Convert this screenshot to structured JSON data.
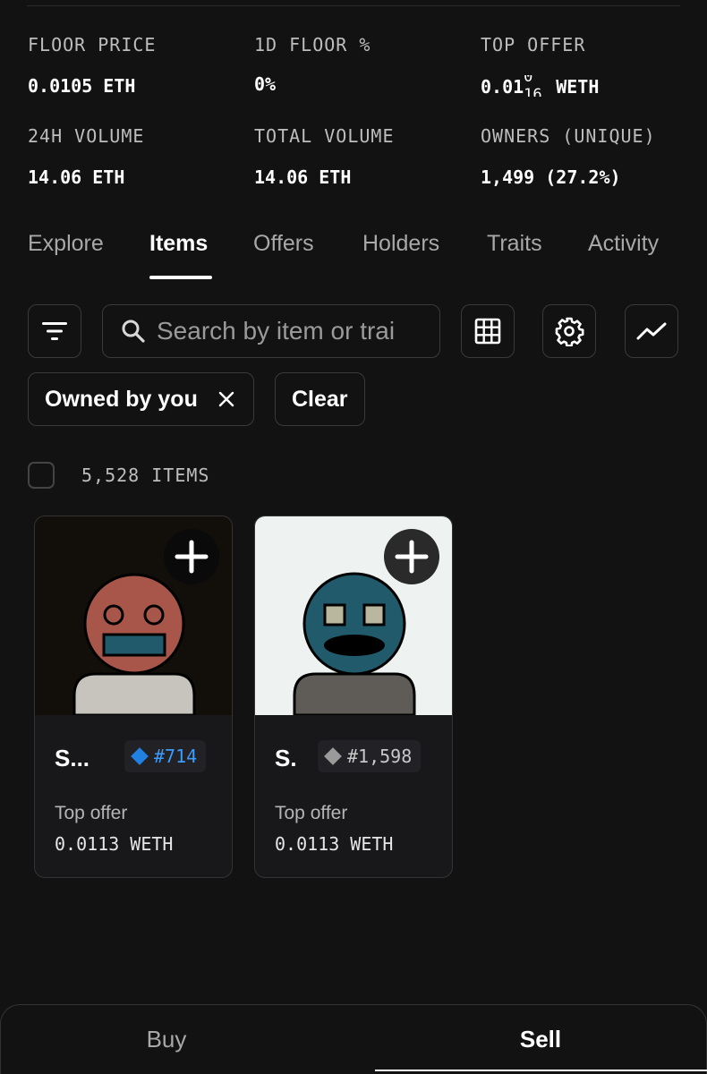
{
  "stats": [
    {
      "label": "FLOOR PRICE",
      "value": "0.0105 ETH"
    },
    {
      "label": "1D FLOOR %",
      "value": "0%"
    },
    {
      "label": "TOP OFFER",
      "value_prefix": "0.01",
      "ticker_top": "0",
      "ticker_bottom": "16",
      "value_suffix": "WETH"
    },
    {
      "label": "24H VOLUME",
      "value": "14.06 ETH"
    },
    {
      "label": "TOTAL VOLUME",
      "value": "14.06 ETH"
    },
    {
      "label": "OWNERS (UNIQUE)",
      "value": "1,499 (27.2%)"
    }
  ],
  "tabs": [
    {
      "label": "Explore",
      "active": false
    },
    {
      "label": "Items",
      "active": true
    },
    {
      "label": "Offers",
      "active": false
    },
    {
      "label": "Holders",
      "active": false
    },
    {
      "label": "Traits",
      "active": false
    },
    {
      "label": "Activity",
      "active": false
    }
  ],
  "search": {
    "placeholder": "Search by item or trai",
    "value": ""
  },
  "toolbar_icons": [
    "filter-icon",
    "search-icon",
    "grid-icon",
    "gear-icon",
    "trend-chart-icon"
  ],
  "chips": {
    "owned_by_you": "Owned by you",
    "clear": "Clear",
    "chip_close_icon": "close-icon"
  },
  "results": {
    "count_label": "5,528 ITEMS"
  },
  "cards": [
    {
      "name": "S...",
      "token": "#714",
      "badge_color": "#2081e2",
      "token_color": "#3b9cff",
      "offer_label": "Top offer",
      "offer_value": "0.0113 WETH",
      "bg": "#120f0a",
      "face": "#a8564a",
      "body": "#c6c4bd"
    },
    {
      "name": "S.",
      "token": "#1,598",
      "badge_color": "#9a9a9a",
      "token_color": "#c8c8c8",
      "offer_label": "Top offer",
      "offer_value": "0.0113 WETH",
      "bg": "#eef3f1",
      "face": "#215a6a",
      "body": "#5f5b57"
    }
  ],
  "bottom": {
    "buy": "Buy",
    "sell": "Sell"
  }
}
